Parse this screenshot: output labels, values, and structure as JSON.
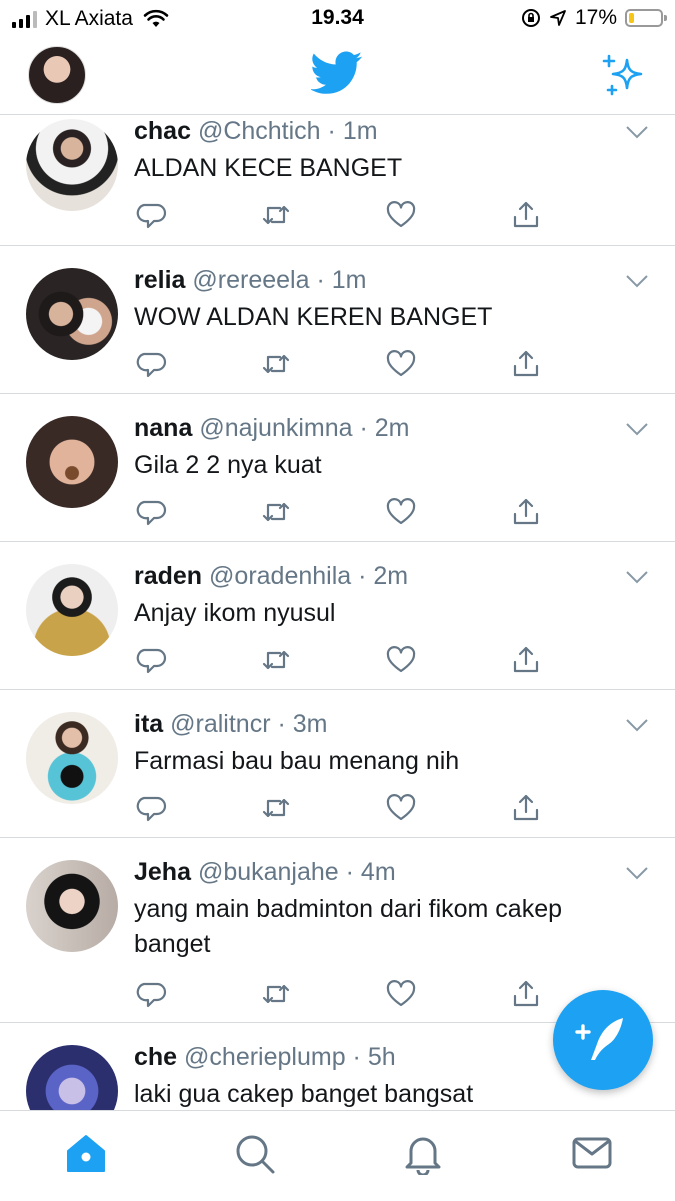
{
  "status_bar": {
    "carrier": "XL Axiata",
    "time": "19.34",
    "battery": "17%",
    "battery_level": 0.17
  },
  "header": {
    "logo_icon": "twitter-bird-icon",
    "sparkle_icon": "sparkle-icon"
  },
  "colors": {
    "accent": "#1da1f2",
    "text": "#14171a",
    "muted": "#657786",
    "divider": "#d7dbde"
  },
  "tweets": [
    {
      "name": "chac",
      "handle": "@Chchtich",
      "time": "1m",
      "text": "ALDAN KECE BANGET"
    },
    {
      "name": "relia",
      "handle": "@rereeela",
      "time": "1m",
      "text": "WOW ALDAN KEREN BANGET"
    },
    {
      "name": "nana",
      "handle": "@najunkimna",
      "time": "2m",
      "text": "Gila 2 2 nya kuat"
    },
    {
      "name": "raden",
      "handle": "@oradenhila",
      "time": "2m",
      "text": "Anjay ikom nyusul"
    },
    {
      "name": "ita",
      "handle": "@ralitncr",
      "time": "3m",
      "text": "Farmasi bau bau menang nih"
    },
    {
      "name": "Jeha",
      "handle": "@bukanjahe",
      "time": "4m",
      "text": "yang main badminton dari fikom cakep banget"
    },
    {
      "name": "che",
      "handle": "@cherieplump",
      "time": "5h",
      "text": "laki gua cakep banget bangsat"
    }
  ],
  "tabs": [
    "home-icon",
    "search-icon",
    "notifications-icon",
    "messages-icon"
  ]
}
